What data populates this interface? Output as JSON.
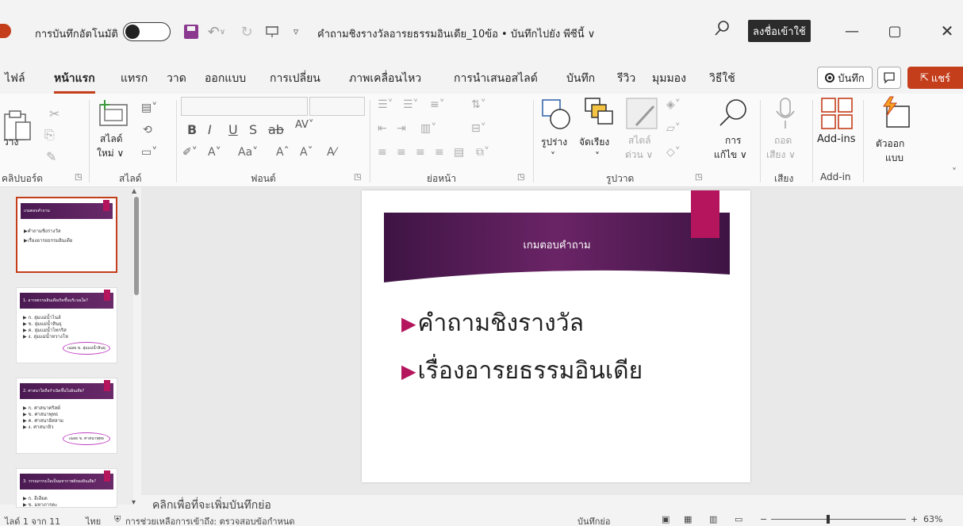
{
  "titlebar": {
    "autosave_label": "การบันทึกอัตโนมัติ",
    "doc_title": "คำถามชิงรางวัลอารยธรรมอินเดีย_10ข้อ • บันทึกไปยัง พีซีนี้ ∨",
    "signin_label": "ลงชื่อเข้าใช้",
    "minimize": "—",
    "maximize": "▢",
    "close": "✕"
  },
  "tabs": [
    {
      "label": "ไฟล์"
    },
    {
      "label": "หน้าแรก"
    },
    {
      "label": "แทรก"
    },
    {
      "label": "วาด"
    },
    {
      "label": "ออกแบบ"
    },
    {
      "label": "การเปลี่ยน"
    },
    {
      "label": "ภาพเคลื่อนไหว"
    },
    {
      "label": "การนำเสนอสไลด์"
    },
    {
      "label": "บันทึก"
    },
    {
      "label": "รีวิว"
    },
    {
      "label": "มุมมอง"
    },
    {
      "label": "วิธีใช้"
    }
  ],
  "ribbon_actions": {
    "record": "บันทึก",
    "share": "แชร์"
  },
  "ribbon": {
    "paste_label": "วาง",
    "new_slide_label_1": "สไลด์",
    "new_slide_label_2": "ใหม่ ∨",
    "shapes_label": "รูปร่าง",
    "arrange_label": "จัดเรียง",
    "quick_styles_1": "สไตล์",
    "quick_styles_2": "ด่วน ∨",
    "editing_label_1": "การ",
    "editing_label_2": "แก้ไข ∨",
    "dictate_label_1": "ถอด",
    "dictate_label_2": "เสียง ∨",
    "addins_label": "Add-ins",
    "designer_label_1": "ตัวออก",
    "designer_label_2": "แบบ",
    "groups": {
      "clipboard": "คลิปบอร์ด",
      "slides": "สไลด์",
      "font": "ฟอนต์",
      "paragraph": "ย่อหน้า",
      "drawing": "รูปวาด",
      "voice": "เสียง",
      "addin": "Add-in"
    }
  },
  "thumbnails": [
    {
      "title": "เกมตอบคำถาม",
      "lines": [
        "▶คำถามชิงรางวัล",
        "▶เรื่องอารยธรรมอินเดีย"
      ]
    },
    {
      "title": "1. อารยธรรมอินเดียเกิดขึ้นบริเวณใด?",
      "lines": [
        "▶ ก. ลุ่มแม่น้ำไนล์",
        "▶ ข. ลุ่มแม่น้ำสินธุ",
        "▶ ค. ลุ่มแม่น้ำไทกริส",
        "▶ ง. ลุ่มแม่น้ำหวางโห"
      ],
      "answer": "เฉลย ข. ลุ่มแม่น้ำสินธุ"
    },
    {
      "title": "2. ศาสนาใดถือกำเนิดขึ้นในอินเดีย?",
      "lines": [
        "▶ ก. ศาสนาคริสต์",
        "▶ ข. ศาสนาพุทธ",
        "▶ ค. ศาสนาอิสลาม",
        "▶ ง. ศาสนายิว"
      ],
      "answer": "เฉลย ข. ศาสนาพุทธ"
    },
    {
      "title": "3. วรรณกรรมใดเป็นมหากาพย์ของอินเดีย?",
      "lines": [
        "▶ ก. อีเลียด",
        "▶ ข. มหาภารตะ"
      ]
    }
  ],
  "slide": {
    "title": "เกมตอบคำถาม",
    "bullets": [
      "คำถามชิงรางวัล",
      "เรื่องอารยธรรมอินเดีย"
    ]
  },
  "notes_placeholder": "คลิกเพื่อที่จะเพิ่มบันทึกย่อ",
  "status": {
    "slide_count": "ไลด์ 1 จาก 11",
    "language": "ไทย",
    "accessibility": "การช่วยเหลือการเข้าถึง: ตรวจสอบข้อกำหนด",
    "notes_btn": "บันทึกย่อ",
    "zoom": "63%"
  },
  "colors": {
    "accent": "#c43e1c",
    "slide_magenta": "#b4155d",
    "slide_purple": "#4a1a52"
  }
}
